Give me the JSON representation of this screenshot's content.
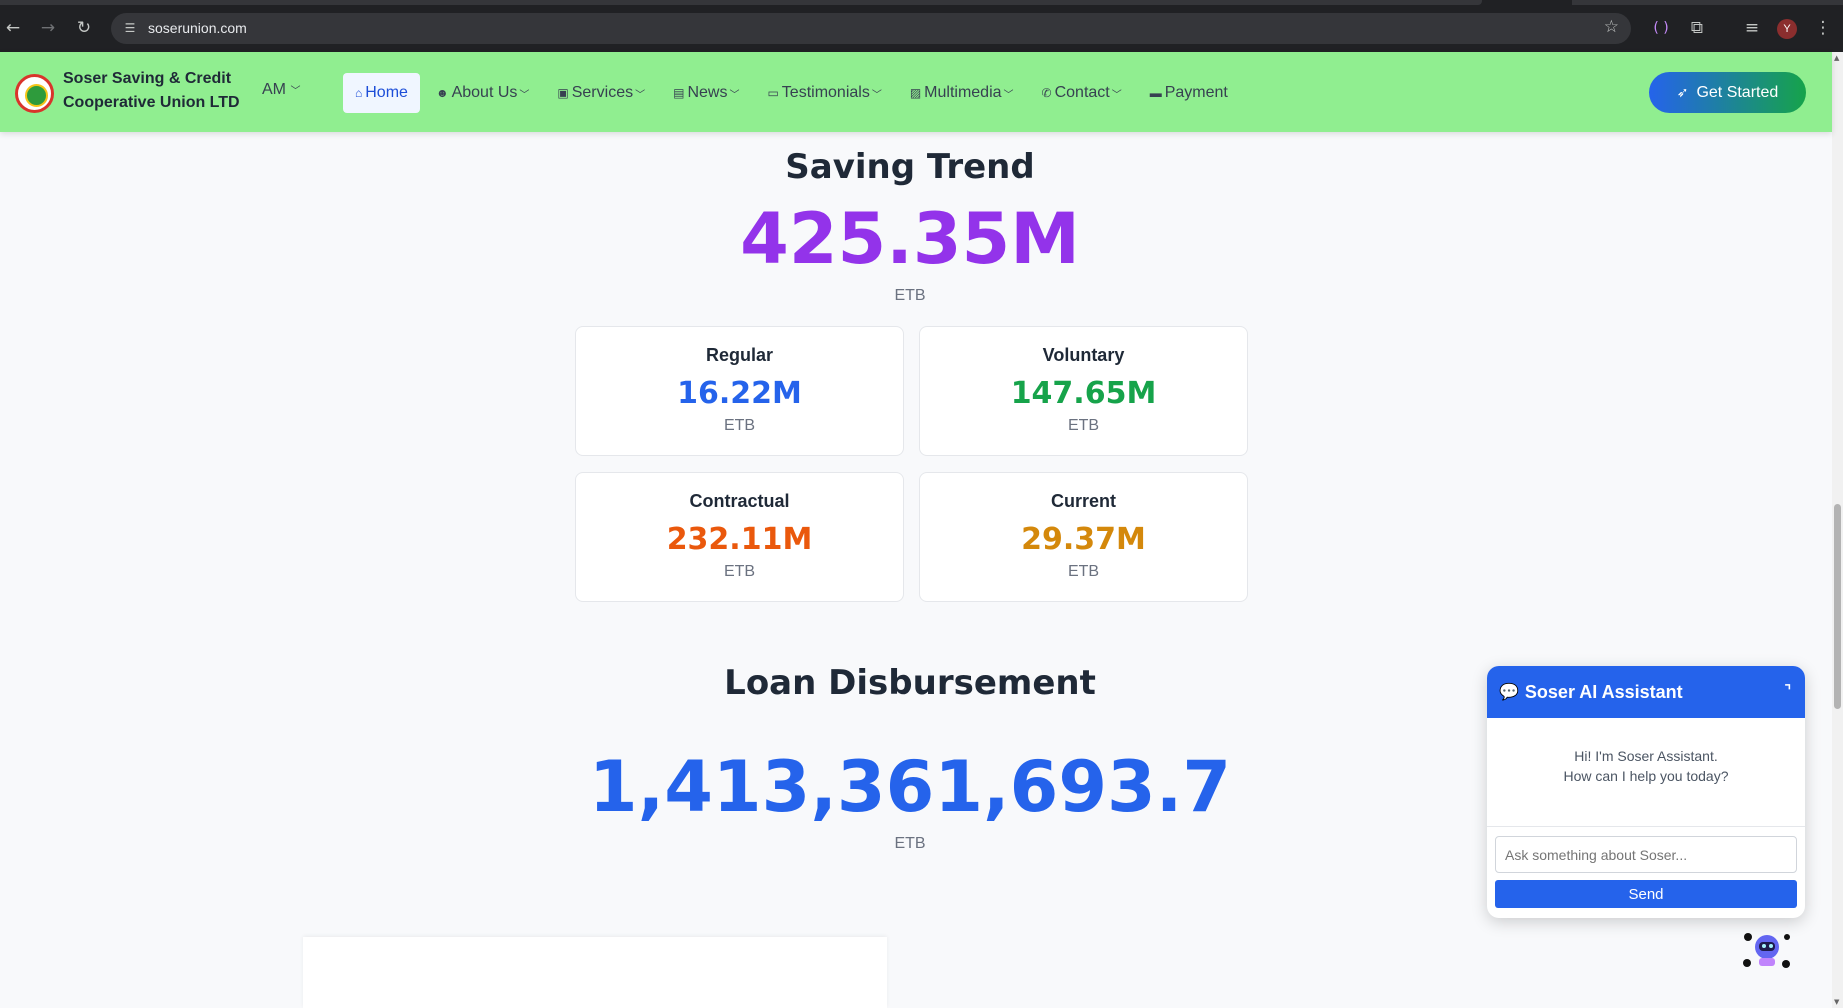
{
  "browser": {
    "url": "soserunion.com",
    "profile_initial": "Y"
  },
  "icons": {
    "back": "back-arrow-icon",
    "forward": "forward-arrow-icon",
    "reload": "reload-icon",
    "site_settings": "tune-icon",
    "bookmark": "star-icon",
    "extensions": "puzzle-icon",
    "menu": "kebab-menu-icon"
  },
  "navbar": {
    "brand_line1": "Soser Saving & Credit",
    "brand_line2": "Cooperative Union LTD",
    "language": "AM",
    "items": [
      {
        "label": "Home",
        "icon": "home-icon"
      },
      {
        "label": "About Us",
        "icon": "people-icon"
      },
      {
        "label": "Services",
        "icon": "briefcase-icon"
      },
      {
        "label": "News",
        "icon": "newspaper-icon"
      },
      {
        "label": "Testimonials",
        "icon": "chat-quote-icon"
      },
      {
        "label": "Multimedia",
        "icon": "image-icon"
      },
      {
        "label": "Contact",
        "icon": "phone-icon"
      },
      {
        "label": "Payment",
        "icon": "card-icon"
      }
    ],
    "cta": "Get Started",
    "colors": {
      "bar": "#90ee90",
      "cta_start": "#2563eb",
      "cta_end": "#16a34a"
    }
  },
  "saving": {
    "title": "Saving Trend",
    "total": "425.35M",
    "unit": "ETB",
    "cards": [
      {
        "label": "Regular",
        "value": "16.22M",
        "unit": "ETB",
        "color": "#2563eb"
      },
      {
        "label": "Voluntary",
        "value": "147.65M",
        "unit": "ETB",
        "color": "#16a34a"
      },
      {
        "label": "Contractual",
        "value": "232.11M",
        "unit": "ETB",
        "color": "#ea580c"
      },
      {
        "label": "Current",
        "value": "29.37M",
        "unit": "ETB",
        "color": "#d4880b"
      }
    ],
    "total_color": "#9333ea"
  },
  "loan": {
    "title": "Loan Disbursement",
    "value": "1,413,361,693.7",
    "unit": "ETB",
    "color": "#2563eb"
  },
  "chat": {
    "title": "Soser AI Assistant",
    "greeting1": "Hi! I'm Soser Assistant.",
    "greeting2": "How can I help you today?",
    "placeholder": "Ask something about Soser...",
    "send": "Send"
  }
}
